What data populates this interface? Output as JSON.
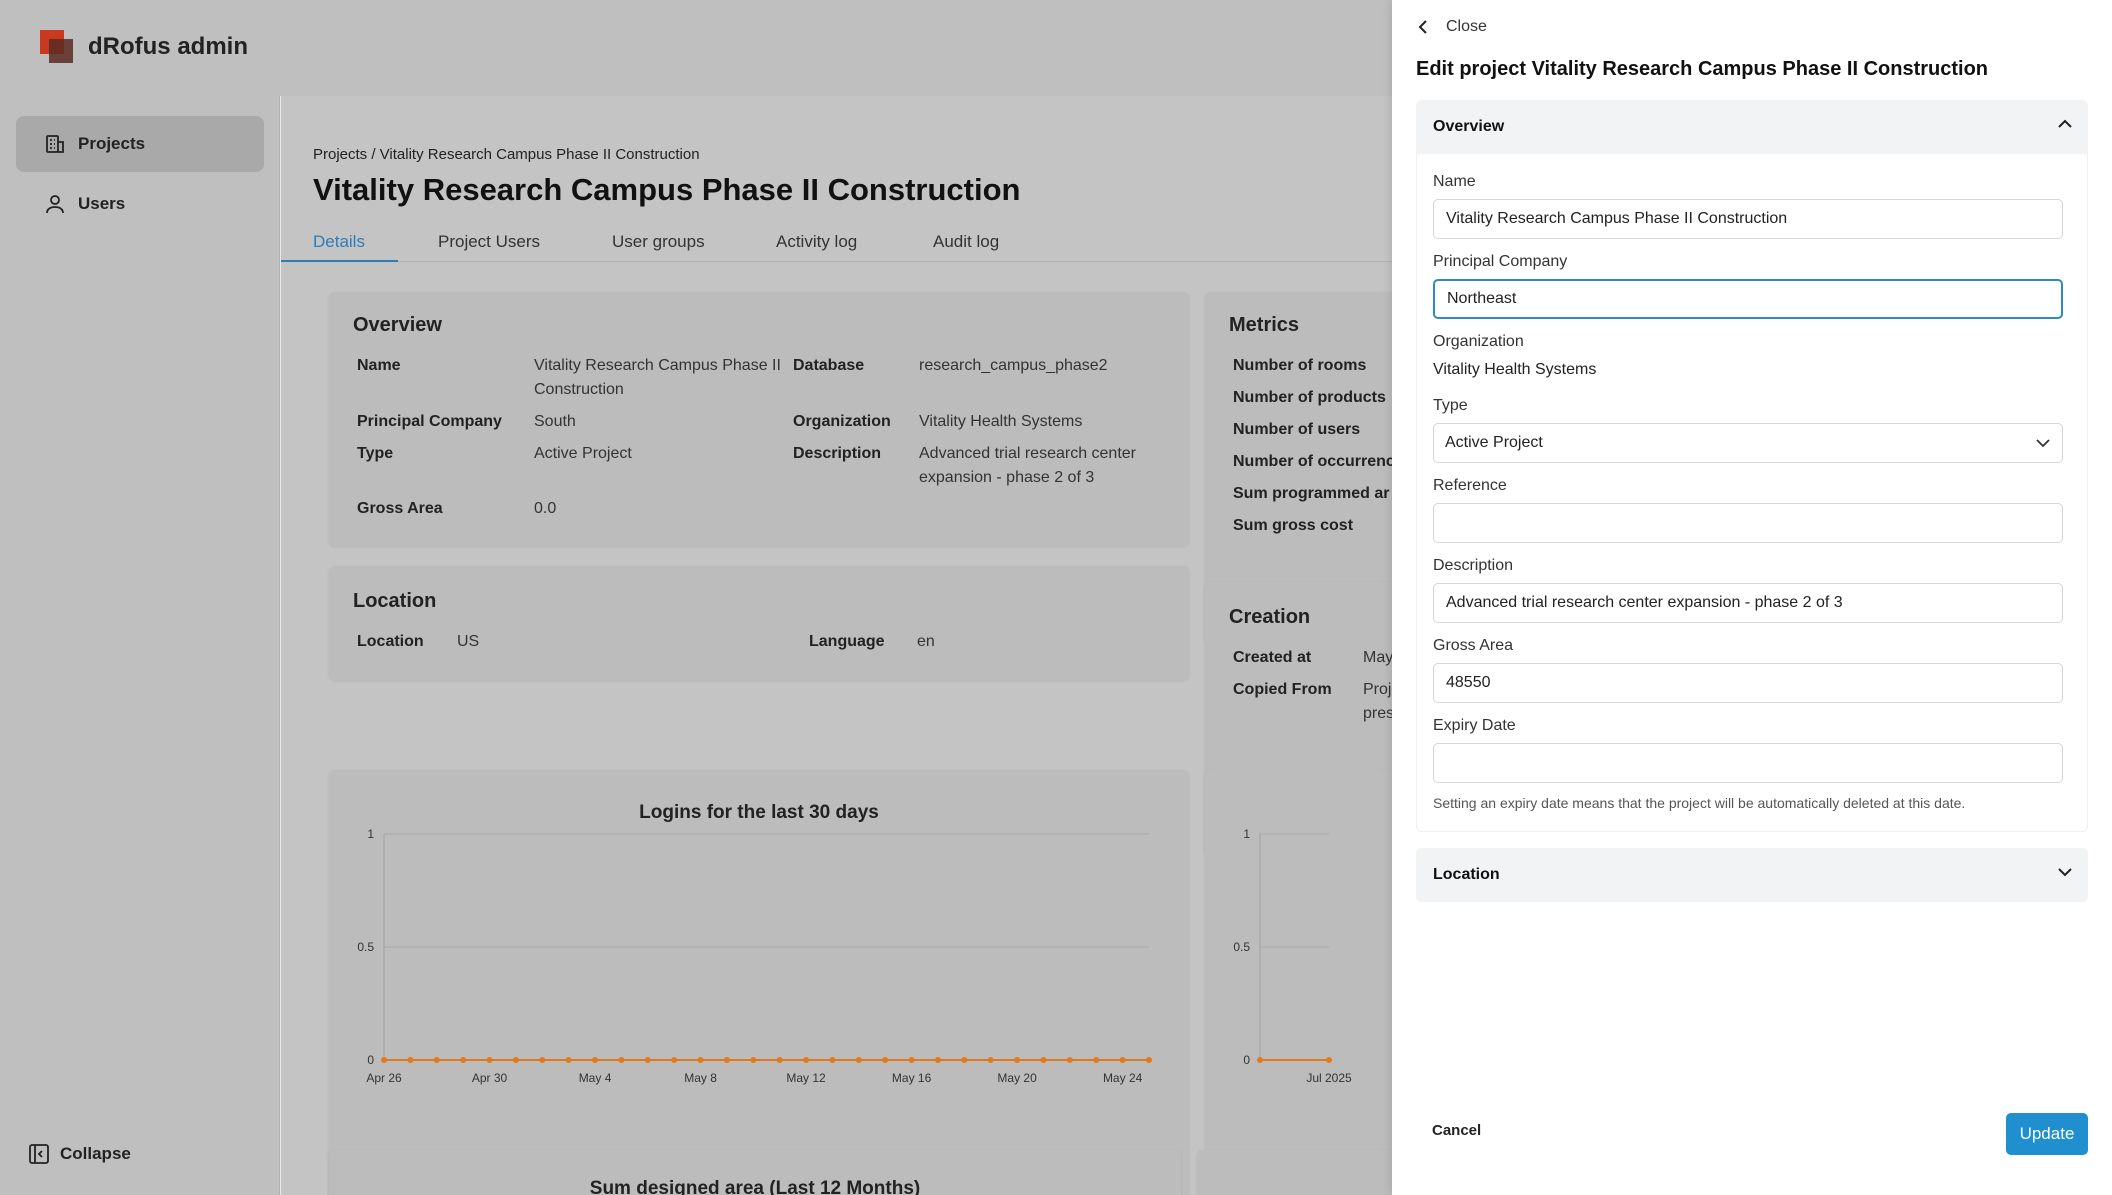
{
  "app": {
    "title": "dRofus admin"
  },
  "sidebar": {
    "items": [
      {
        "label": "Projects",
        "icon": "building-icon",
        "active": true
      },
      {
        "label": "Users",
        "icon": "user-icon",
        "active": false
      }
    ],
    "collapse_label": "Collapse"
  },
  "page": {
    "breadcrumb": "Projects / Vitality Research Campus Phase II Construction",
    "title": "Vitality Research Campus Phase II Construction",
    "tabs": [
      "Details",
      "Project Users",
      "User groups",
      "Activity log",
      "Audit log"
    ],
    "active_tab": "Details"
  },
  "overview_card": {
    "title": "Overview",
    "name_label": "Name",
    "name_value": "Vitality Research Campus Phase II Construction",
    "database_label": "Database",
    "database_value": "research_campus_phase2",
    "principal_label": "Principal Company",
    "principal_value": "South",
    "organization_label": "Organization",
    "organization_value": "Vitality Health Systems",
    "type_label": "Type",
    "type_value": "Active Project",
    "description_label": "Description",
    "description_value": "Advanced trial research center expansion - phase 2 of 3",
    "gross_label": "Gross Area",
    "gross_value": "0.0"
  },
  "location_card": {
    "title": "Location",
    "location_label": "Location",
    "location_value": "US",
    "language_label": "Language",
    "language_value": "en"
  },
  "metrics_card": {
    "title": "Metrics",
    "labels": [
      "Number of rooms",
      "Number of products",
      "Number of users",
      "Number of occurrenc",
      "Sum programmed ar",
      "Sum gross cost"
    ]
  },
  "creation_card": {
    "title": "Creation",
    "created_label": "Created at",
    "created_value": "May",
    "copied_label": "Copied From",
    "copied_value_1": "Proj",
    "copied_value_2": "pres"
  },
  "bottom_card": {
    "title_partial": "Sum designed area (Last 12 Months)"
  },
  "chart_data": [
    {
      "type": "line",
      "title": "Logins for the last 30 days",
      "x": [
        "Apr 26",
        "Apr 27",
        "Apr 28",
        "Apr 29",
        "Apr 30",
        "May 1",
        "May 2",
        "May 3",
        "May 4",
        "May 5",
        "May 6",
        "May 7",
        "May 8",
        "May 9",
        "May 10",
        "May 11",
        "May 12",
        "May 13",
        "May 14",
        "May 15",
        "May 16",
        "May 17",
        "May 18",
        "May 19",
        "May 20",
        "May 21",
        "May 22",
        "May 23",
        "May 24",
        "May 25"
      ],
      "x_tick_labels": [
        "Apr 26",
        "Apr 30",
        "May 4",
        "May 8",
        "May 12",
        "May 16",
        "May 20",
        "May 24"
      ],
      "series": [
        {
          "values": [
            0,
            0,
            0,
            0,
            0,
            0,
            0,
            0,
            0,
            0,
            0,
            0,
            0,
            0,
            0,
            0,
            0,
            0,
            0,
            0,
            0,
            0,
            0,
            0,
            0,
            0,
            0,
            0,
            0,
            0
          ]
        }
      ],
      "y_ticks": [
        "0",
        "0.5",
        "1"
      ],
      "ylim": [
        0,
        1
      ],
      "color": "#e07a1f",
      "grid": true
    },
    {
      "type": "line",
      "title": "",
      "x_tick_labels": [
        "Jul 2025"
      ],
      "series": [
        {
          "values": [
            0,
            0
          ]
        }
      ],
      "y_ticks": [
        "0",
        "0.5",
        "1"
      ],
      "ylim": [
        0,
        1
      ],
      "color": "#e07a1f",
      "grid": true
    }
  ],
  "drawer": {
    "close_label": "Close",
    "title": "Edit project Vitality Research Campus Phase II Construction",
    "overview_section": "Overview",
    "location_section": "Location",
    "fields": {
      "name_label": "Name",
      "name_value": "Vitality Research Campus Phase II Construction",
      "principal_label": "Principal Company",
      "principal_value": "Northeast",
      "organization_label": "Organization",
      "organization_value": "Vitality Health Systems",
      "type_label": "Type",
      "type_value": "Active Project",
      "reference_label": "Reference",
      "reference_value": "",
      "description_label": "Description",
      "description_value": "Advanced trial research center expansion - phase 2 of 3",
      "gross_label": "Gross Area",
      "gross_value": "48550",
      "expiry_label": "Expiry Date",
      "expiry_value": "",
      "expiry_hint": "Setting an expiry date means that the project will be automatically deleted at this date."
    },
    "cancel_label": "Cancel",
    "update_label": "Update",
    "accent": "#1f8fcf"
  }
}
